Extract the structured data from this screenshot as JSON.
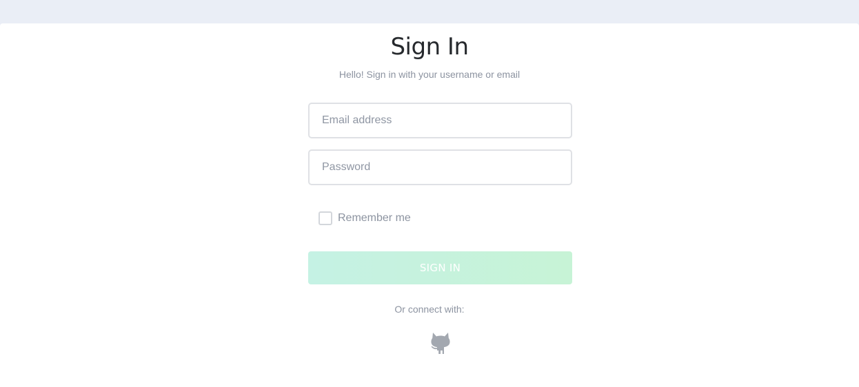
{
  "signin": {
    "title": "Sign In",
    "subtitle": "Hello! Sign in with your username or email",
    "email_placeholder": "Email address",
    "password_placeholder": "Password",
    "remember_label": "Remember me",
    "remember_checked": false,
    "button_label": "SIGN IN",
    "connect_label": "Or connect with:",
    "social_icon": "github-icon"
  },
  "colors": {
    "page_background": "#eaeef6",
    "card_background": "#ffffff",
    "button_gradient_start": "#c5f2e4",
    "button_gradient_end": "#c7f3d6",
    "muted_text": "#8c93a0",
    "title_text": "#26292d"
  }
}
